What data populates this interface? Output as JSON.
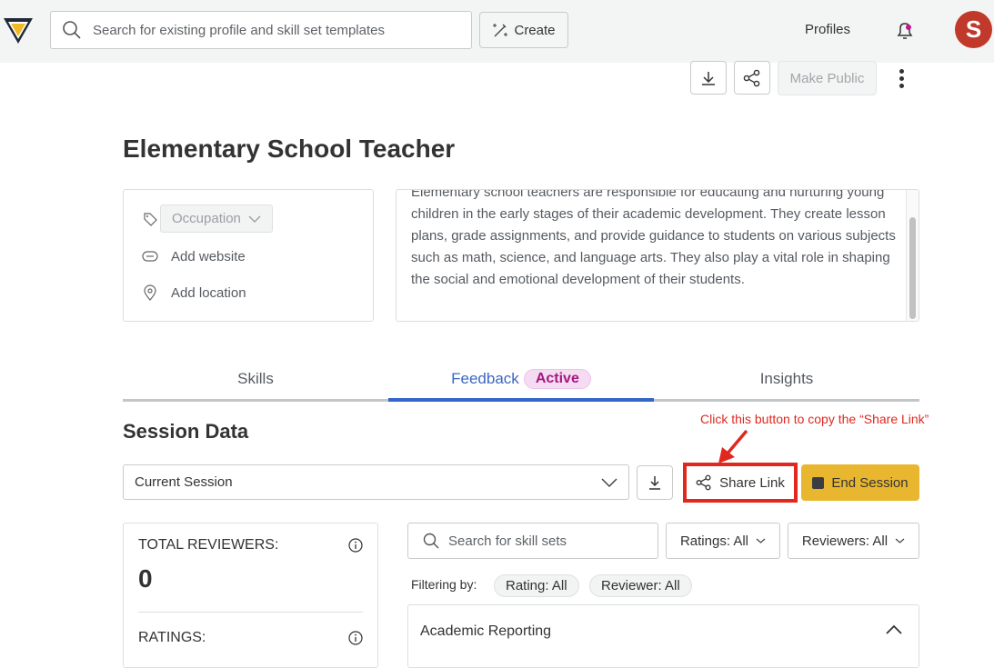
{
  "header": {
    "search_placeholder": "Search for existing profile and skill set templates",
    "create_label": "Create",
    "nav_profiles": "Profiles",
    "avatar_initial": "S",
    "notification_dot_color": "#c2168f"
  },
  "toolbar": {
    "download_icon": "download-icon",
    "share_icon": "share-icon",
    "make_public_label": "Make Public",
    "more_icon": "more-vertical-icon"
  },
  "profile": {
    "title": "Elementary School Teacher",
    "occupation_label": "Occupation",
    "add_website_label": "Add website",
    "add_location_label": "Add location",
    "description": "Elementary school teachers are responsible for educating and nurturing young children in the early stages of their academic development. They create lesson plans, grade assignments, and provide guidance to students on various subjects such as math, science, and language arts. They also play a vital role in shaping the social and emotional development of their students."
  },
  "tabs": [
    {
      "label": "Skills",
      "active": false
    },
    {
      "label": "Feedback",
      "active": true,
      "badge": "Active"
    },
    {
      "label": "Insights",
      "active": false
    }
  ],
  "session": {
    "section_title": "Session Data",
    "selected_session": "Current Session",
    "share_link_label": "Share Link",
    "end_session_label": "End Session",
    "annotation": "Click this button to copy the “Share Link”"
  },
  "stats": {
    "total_reviewers_label": "TOTAL REVIEWERS:",
    "total_reviewers_value": "0",
    "ratings_label": "RATINGS:"
  },
  "filters": {
    "search_placeholder": "Search for skill sets",
    "ratings_dropdown": "Ratings: All",
    "reviewers_dropdown": "Reviewers: All",
    "filtering_by_label": "Filtering by:",
    "chips": [
      "Rating: All",
      "Reviewer: All"
    ]
  },
  "skill_sets": [
    {
      "title": "Academic Reporting",
      "expanded": true
    }
  ],
  "colors": {
    "accent_blue": "#3565c9",
    "end_session_yellow": "#e9b62f",
    "annotation_red": "#e0281f",
    "avatar_red": "#c0392b",
    "active_badge_text": "#a3197f"
  }
}
